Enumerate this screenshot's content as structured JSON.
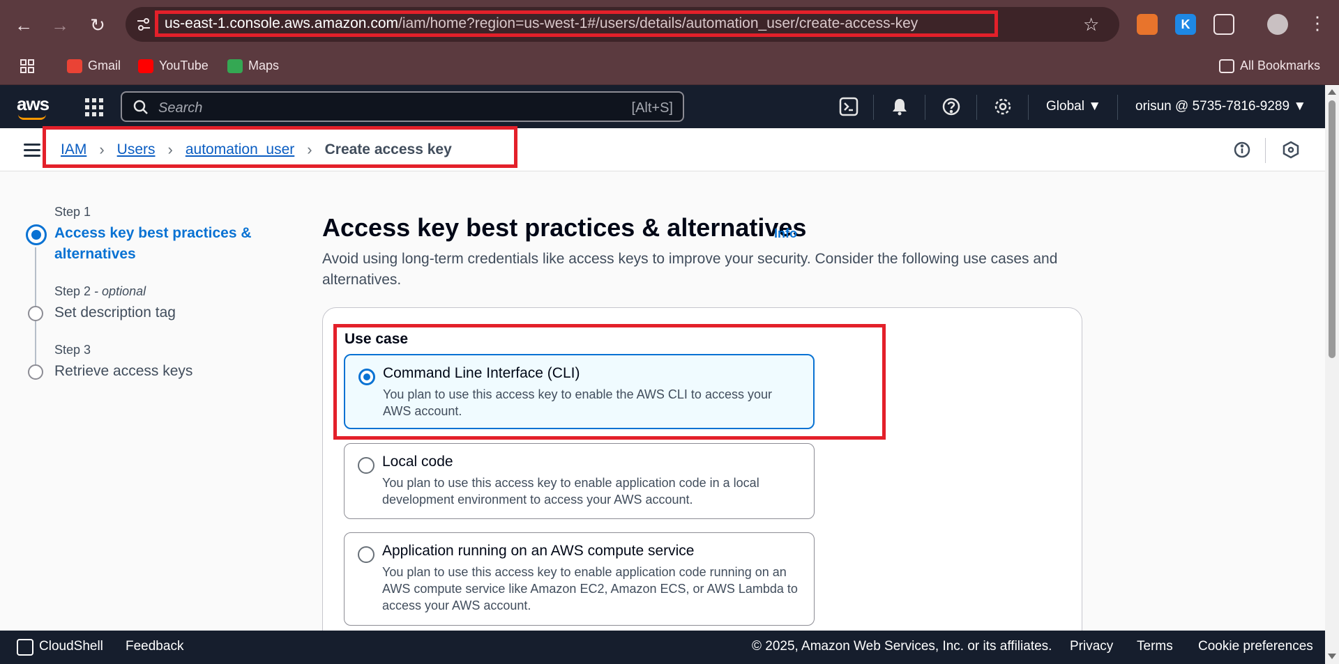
{
  "browser": {
    "url_host": "us-east-1.console.aws.amazon.com",
    "url_path": "/iam/home?region=us-west-1#/users/details/automation_user/create-access-key",
    "bookmarks": [
      {
        "label": "Gmail",
        "color": "#ea4335"
      },
      {
        "label": "YouTube",
        "color": "#ff0000"
      },
      {
        "label": "Maps",
        "color": "#34a853"
      }
    ],
    "all_bookmarks": "All Bookmarks"
  },
  "aws_nav": {
    "search_placeholder": "Search",
    "search_shortcut": "[Alt+S]",
    "region": "Global ▼",
    "account": "orisun @ 5735-7816-9289 ▼"
  },
  "breadcrumb": {
    "items": [
      "IAM",
      "Users",
      "automation_user"
    ],
    "current": "Create access key"
  },
  "steps": [
    {
      "label": "Step 1",
      "optional": "",
      "title": "Access key best practices & alternatives",
      "active": true
    },
    {
      "label": "Step 2",
      "optional": " - optional",
      "title": "Set description tag",
      "active": false
    },
    {
      "label": "Step 3",
      "optional": "",
      "title": "Retrieve access keys",
      "active": false
    }
  ],
  "main": {
    "title": "Access key best practices & alternatives",
    "info": "Info",
    "description": "Avoid using long-term credentials like access keys to improve your security. Consider the following use cases and alternatives.",
    "use_case_label": "Use case",
    "options": [
      {
        "title": "Command Line Interface (CLI)",
        "desc": "You plan to use this access key to enable the AWS CLI to access your AWS account.",
        "selected": true
      },
      {
        "title": "Local code",
        "desc": "You plan to use this access key to enable application code in a local development environment to access your AWS account.",
        "selected": false
      },
      {
        "title": "Application running on an AWS compute service",
        "desc": "You plan to use this access key to enable application code running on an AWS compute service like Amazon EC2, Amazon ECS, or AWS Lambda to access your AWS account.",
        "selected": false
      }
    ]
  },
  "footer": {
    "cloudshell": "CloudShell",
    "feedback": "Feedback",
    "copyright": "© 2025, Amazon Web Services, Inc. or its affiliates.",
    "privacy": "Privacy",
    "terms": "Terms",
    "cookies": "Cookie preferences"
  },
  "colors": {
    "accent": "#0972d3",
    "highlight": "#e3202a",
    "aws_dark": "#161e2d"
  }
}
